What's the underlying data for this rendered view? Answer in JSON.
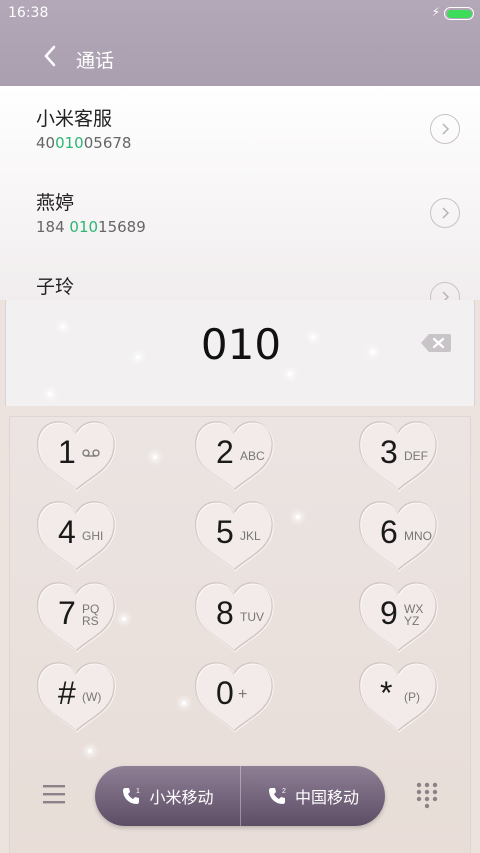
{
  "status_bar": {
    "time": "16:38"
  },
  "header": {
    "title": "通话"
  },
  "contacts": [
    {
      "name": "小米客服",
      "num_pre": "40",
      "num_hl": "010",
      "num_post": "05678"
    },
    {
      "name": "燕婷",
      "num_pre": "184 ",
      "num_hl": "010",
      "num_post": "15689"
    },
    {
      "name": "子玲",
      "num_pre": "",
      "num_hl": "",
      "num_post": ""
    }
  ],
  "dialer": {
    "input": "010"
  },
  "keys": [
    {
      "main": "1",
      "sub": ""
    },
    {
      "main": "2",
      "sub": "ABC"
    },
    {
      "main": "3",
      "sub": "DEF"
    },
    {
      "main": "4",
      "sub": "GHI"
    },
    {
      "main": "5",
      "sub": "JKL"
    },
    {
      "main": "6",
      "sub": "MNO"
    },
    {
      "main": "7",
      "sub": "PQ",
      "sub2": "RS"
    },
    {
      "main": "8",
      "sub": "TUV"
    },
    {
      "main": "9",
      "sub": "WX",
      "sub2": "YZ"
    },
    {
      "main": "#",
      "sub": "(W)"
    },
    {
      "main": "0",
      "sub": "+"
    },
    {
      "main": "*",
      "sub": "(P)"
    }
  ],
  "call_buttons": [
    {
      "label": "小米移动",
      "sim": "1"
    },
    {
      "label": "中国移动",
      "sim": "2"
    }
  ],
  "icons": {
    "back": "chevron-left-icon",
    "voicemail": "voicemail-icon",
    "backspace": "backspace-icon",
    "menu": "menu-icon",
    "dialpad": "dialpad-icon"
  },
  "colors": {
    "match_highlight": "#2bb673",
    "header_bg": "#aa9faf",
    "call_button": "#6e5f76"
  }
}
